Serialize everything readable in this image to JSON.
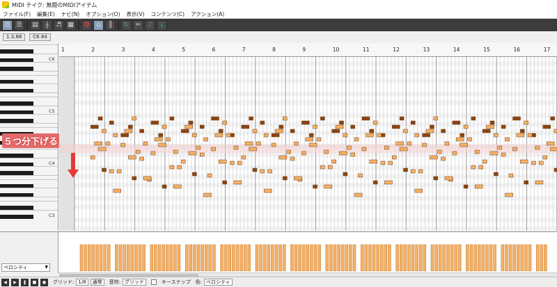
{
  "window": {
    "title": "MIDI テイク: 無題のMIDIアイテム"
  },
  "menu": [
    "ファイル(F)",
    "編集(E)",
    "ナビ(N)",
    "オプション(O)",
    "表示(V)",
    "コンテンツ(C)",
    "アクション(A)"
  ],
  "toolbar": {
    "buttons": [
      {
        "icon": "list-icon",
        "glyph": "☰",
        "style": "active"
      },
      {
        "icon": "list-icon",
        "glyph": "☰",
        "style": ""
      },
      {
        "icon": "grid-icon",
        "glyph": "▤",
        "style": ""
      },
      {
        "icon": "treble-clef-icon",
        "glyph": "𝄞",
        "style": ""
      },
      {
        "icon": "chord-icon",
        "glyph": "♬",
        "style": ""
      },
      {
        "icon": "grid-icon",
        "glyph": "▦",
        "style": ""
      },
      {
        "icon": "quantize-icon",
        "glyph": "Q",
        "style": "red"
      },
      {
        "icon": "snap-icon",
        "glyph": "⌂",
        "style": "active"
      },
      {
        "icon": "pencil-icon",
        "glyph": "║",
        "style": ""
      },
      {
        "icon": "loop-icon",
        "glyph": "↻",
        "style": "green"
      },
      {
        "icon": "record-icon",
        "glyph": "✂",
        "style": ""
      },
      {
        "icon": "note-icon",
        "glyph": "♪",
        "style": "green"
      },
      {
        "icon": "download-icon",
        "glyph": "⤓",
        "style": "green"
      }
    ]
  },
  "info": {
    "position": "1.3.88",
    "note": "C6  84"
  },
  "ruler": {
    "measures": [
      "1",
      "2",
      "3",
      "4",
      "5",
      "6",
      "7",
      "8",
      "9",
      "10",
      "11",
      "12",
      "13",
      "14",
      "15",
      "16",
      "17"
    ]
  },
  "piano": {
    "octaves": [
      "C6",
      "C5",
      "C4",
      "C3"
    ]
  },
  "callout": {
    "text": "５つ分下げる"
  },
  "velocity": {
    "lane_label": "ベロシティ"
  },
  "status": {
    "grid_label": "グリッド:",
    "grid_value": "1/8",
    "grid_mode": "通常",
    "sound_label": "音符:",
    "sound_value": "グリッド",
    "keysnap_label": "キースナップ",
    "color_label": "色:",
    "color_value": "ベロシティ"
  },
  "colors": {
    "note_orange": "#f5b066",
    "note_brown": "#8b4513",
    "velocity_bar": "#f5b066",
    "accent_red": "#e53935"
  }
}
